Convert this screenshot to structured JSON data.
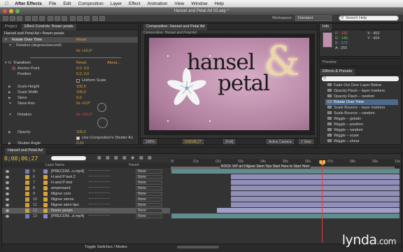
{
  "menubar": {
    "apple": "",
    "app": "After Effects",
    "items": [
      "File",
      "Edit",
      "Composition",
      "Layer",
      "Effect",
      "Animation",
      "View",
      "Window",
      "Help"
    ]
  },
  "window": {
    "title": "Hansel and Petal Ad 03.aep *"
  },
  "toolbar": {
    "workspace_label": "Workspace:",
    "workspace_value": "Standard",
    "search_placeholder": "Search Help"
  },
  "project_tab": "Project",
  "effect_controls": {
    "tab": "Effect Controls: flower petals",
    "breadcrumb": "Hansel and Petal Ad • flower petals",
    "rows": [
      {
        "label": "Rotate Over Time",
        "reset": "Reset",
        "highlight": true
      },
      {
        "label": "Rotation (degrees/second)",
        "value": ""
      },
      {
        "label": "",
        "value": "0x +10,0°"
      },
      {
        "label": "Transform",
        "reset": "Reset",
        "about": "About..."
      },
      {
        "label": "Anchor Point",
        "value": "0,0, 0,0"
      },
      {
        "label": "Position",
        "value": "0,0, 0,0"
      },
      {
        "label": "Uniform Scale",
        "value": ""
      },
      {
        "label": "Scale Height",
        "value": "100,0"
      },
      {
        "label": "Scale Width",
        "value": "100,0"
      },
      {
        "label": "Skew",
        "value": "0,0"
      },
      {
        "label": "Skew Axis",
        "value": "0x +0,0°"
      },
      {
        "label": "Rotation",
        "value": "0x +55,0°"
      },
      {
        "label": "Opacity",
        "value": "100,0"
      },
      {
        "label": "Use Composition's Shutter An",
        "value": ""
      },
      {
        "label": "Shutter Angle",
        "value": "0,00"
      }
    ]
  },
  "composition": {
    "tab": "Composition: Hansel and Petal Ad",
    "title_line1": "hansel",
    "title_line2": "petal",
    "ampersand": "&",
    "footer": {
      "zoom": "100%",
      "timecode": "0;00;06;27",
      "resolution": "(Full)",
      "camera": "Active Camera",
      "view": "1 View"
    }
  },
  "info": {
    "tab": "Info",
    "r": "R : 192",
    "g": "G : 145",
    "b": "B : 173",
    "a": "A : 255",
    "x": "X : 453",
    "y": "Y : 404"
  },
  "preview": {
    "tab": "Preview"
  },
  "effects_presets": {
    "tab": "Effects & Presets",
    "search": "",
    "items": [
      {
        "label": "Fade Out Over Layer Below"
      },
      {
        "label": "Opacity Flash – layer markers"
      },
      {
        "label": "Opacity Flash – random"
      },
      {
        "label": "Rotate Over Time",
        "selected": true
      },
      {
        "label": "Scale Bounce – layer markers"
      },
      {
        "label": "Scale Bounce – random"
      },
      {
        "label": "Wiggle – gelatin"
      },
      {
        "label": "Wiggle – position"
      },
      {
        "label": "Wiggle – random"
      },
      {
        "label": "Wiggle – scale"
      },
      {
        "label": "Wiggle – shear"
      }
    ]
  },
  "timeline": {
    "tab": "Hansel and Petal Ad",
    "timecode": "0;00;06;27",
    "header": {
      "layer_name": "Layer Name",
      "parent": "Parent"
    },
    "ruler_labels": [
      "0f",
      "01s",
      "02s",
      "03s",
      "04s",
      "05s",
      "06s",
      "07s",
      "08s",
      "09s",
      "10s"
    ],
    "comment": "ROCK VIP art Fillgree Stem Tips Start Here to Start Here",
    "footer": "Toggle Switches / Modes",
    "playhead_fraction": 0.67,
    "layers": [
      {
        "num": "5",
        "name": "[PRECOM...o.mp4]",
        "parent": "None",
        "color": "#7a7ab8",
        "type": "precomp",
        "bar_start": 0.0,
        "bar_end": 1.0,
        "bar_color": "#5f8d8d"
      },
      {
        "num": "6",
        "name": "H and P text 2",
        "parent": "None",
        "color": "#c9a040",
        "type": "shape",
        "bar_start": 0.26,
        "bar_end": 1.0,
        "bar_color": "#8f8fb8"
      },
      {
        "num": "7",
        "name": "H and P text",
        "parent": "None",
        "color": "#c9a040",
        "type": "shape",
        "bar_start": 0.26,
        "bar_end": 1.0,
        "bar_color": "#8f8fb8"
      },
      {
        "num": "8",
        "name": "ampersand",
        "parent": "None",
        "color": "#c9a040",
        "type": "shape",
        "bar_start": 0.26,
        "bar_end": 1.0,
        "bar_color": "#8f8fb8"
      },
      {
        "num": "9",
        "name": "filigree core",
        "parent": "None",
        "color": "#c9a040",
        "type": "shape",
        "bar_start": 0.26,
        "bar_end": 1.0,
        "bar_color": "#8f8fb8"
      },
      {
        "num": "10",
        "name": "filigree stems",
        "parent": "None",
        "color": "#c9a040",
        "type": "shape",
        "bar_start": 0.26,
        "bar_end": 1.0,
        "bar_color": "#8f8fb8"
      },
      {
        "num": "11",
        "name": "filigree stem tips",
        "parent": "None",
        "color": "#c9a040",
        "type": "shape",
        "bar_start": 0.26,
        "bar_end": 1.0,
        "bar_color": "#8f8fb8"
      },
      {
        "num": "12",
        "name": "flower petals",
        "parent": "None",
        "color": "#c9a040",
        "type": "shape",
        "bar_start": 0.2,
        "bar_end": 1.0,
        "bar_color": "#9f9fc8",
        "selected": true
      },
      {
        "num": "13",
        "name": "[PRECOM...d.mp4]",
        "parent": "None",
        "color": "#7a7ab8",
        "type": "precomp",
        "bar_start": 0.0,
        "bar_end": 1.0,
        "bar_color": "#5f8d8d"
      }
    ]
  },
  "watermark": {
    "brand": "lynda",
    "suffix": ".com"
  }
}
